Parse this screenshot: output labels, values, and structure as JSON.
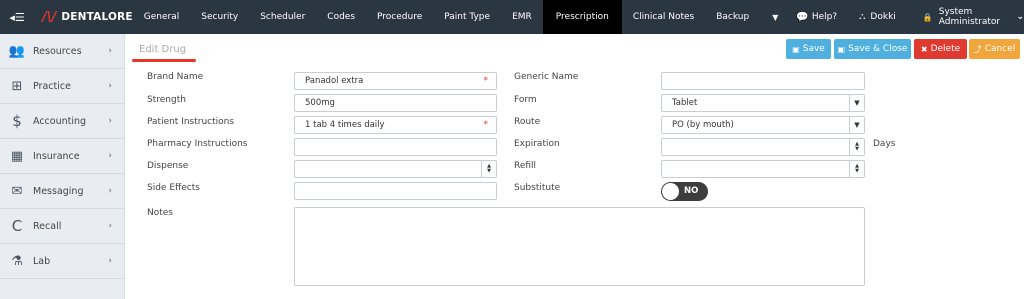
{
  "header": {
    "logo_text": "DENTALORE",
    "nav": [
      "General",
      "Security",
      "Scheduler",
      "Codes",
      "Procedure",
      "Paint Type",
      "EMR",
      "Prescription",
      "Clinical Notes",
      "Backup"
    ],
    "active_tab": "Prescription",
    "help_label": "Help?",
    "user_label": "Dokki",
    "admin_label": "System Administrator"
  },
  "sidebar": {
    "items": [
      {
        "label": "Resources",
        "icon": "users-icon"
      },
      {
        "label": "Practice",
        "icon": "medkit-icon"
      },
      {
        "label": "Accounting",
        "icon": "dollar-icon"
      },
      {
        "label": "Insurance",
        "icon": "building-icon"
      },
      {
        "label": "Messaging",
        "icon": "envelope-icon"
      },
      {
        "label": "Recall",
        "icon": "recall-icon"
      },
      {
        "label": "Lab",
        "icon": "flask-icon"
      }
    ]
  },
  "page": {
    "title": "Edit Drug",
    "buttons": {
      "save": "Save",
      "save_close": "Save & Close",
      "delete": "Delete",
      "cancel": "Cancel"
    }
  },
  "form": {
    "brand_name": {
      "label": "Brand Name",
      "value": "Panadol extra"
    },
    "generic_name": {
      "label": "Generic Name",
      "value": ""
    },
    "strength": {
      "label": "Strength",
      "value": "500mg"
    },
    "form": {
      "label": "Form",
      "value": "Tablet"
    },
    "patient_instructions": {
      "label": "Patient Instructions",
      "value": "1 tab 4 times daily"
    },
    "route": {
      "label": "Route",
      "value": "PO (by mouth)"
    },
    "pharmacy_instructions": {
      "label": "Pharmacy Instructions",
      "value": ""
    },
    "expiration": {
      "label": "Expiration",
      "value": "",
      "unit": "Days"
    },
    "dispense": {
      "label": "Dispense",
      "value": ""
    },
    "refill": {
      "label": "Refill",
      "value": ""
    },
    "side_effects": {
      "label": "Side Effects",
      "value": ""
    },
    "substitute": {
      "label": "Substitute",
      "value": "NO"
    },
    "notes": {
      "label": "Notes",
      "value": ""
    }
  },
  "colors": {
    "topbar": "#2b3643",
    "accent": "#e8352b",
    "save": "#4fb0e0",
    "delete": "#e0392f",
    "cancel": "#f0a63c"
  }
}
